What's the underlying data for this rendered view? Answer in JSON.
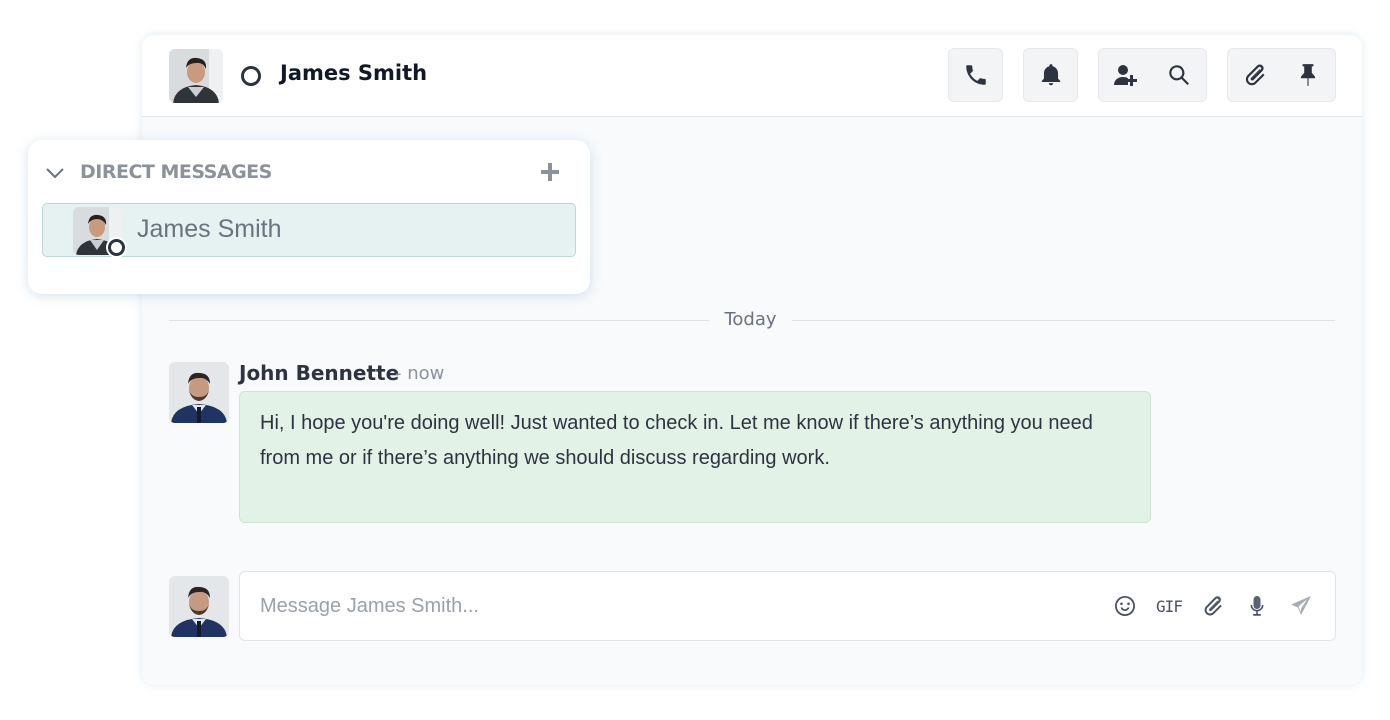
{
  "header": {
    "contact_name": "James Smith",
    "status": "offline",
    "buttons": [
      {
        "name": "call",
        "icon": "phone-icon"
      },
      {
        "name": "notifications",
        "icon": "bell-icon"
      },
      {
        "name": "add-user",
        "icon": "user-plus-icon"
      },
      {
        "name": "search",
        "icon": "search-icon"
      },
      {
        "name": "attachments",
        "icon": "paperclip-icon"
      },
      {
        "name": "pinned",
        "icon": "pin-icon"
      }
    ]
  },
  "sidebar": {
    "section_title": "DIRECT MESSAGES",
    "items": [
      {
        "label": "James Smith",
        "status": "offline",
        "selected": true
      }
    ]
  },
  "conversation": {
    "date_divider": "Today",
    "messages": [
      {
        "author": "John Bennette",
        "time": "- now",
        "text": "Hi, I hope you're doing well! Just wanted to check in. Let me know if there’s anything you need from me or if there’s anything we should discuss regarding work."
      }
    ]
  },
  "composer": {
    "placeholder": "Message James Smith...",
    "value": "",
    "gif_label": "GIF",
    "tools": [
      "emoji-icon",
      "gif-icon",
      "paperclip-icon",
      "microphone-icon",
      "send-icon"
    ]
  },
  "colors": {
    "bubble_bg": "#e3f2e6",
    "selected_item_bg": "#e5f2f1",
    "icon": "#2d3340"
  }
}
